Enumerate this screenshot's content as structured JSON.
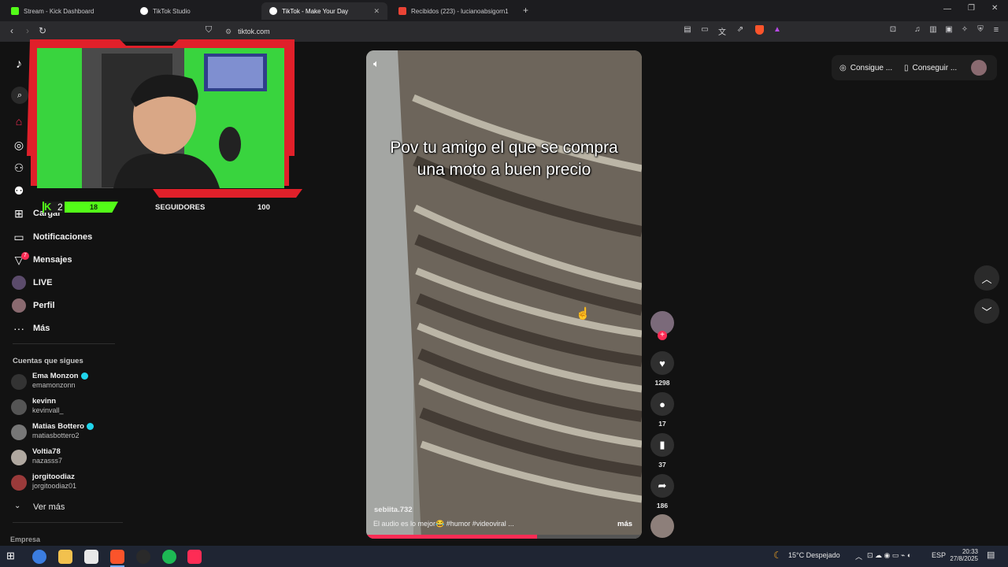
{
  "browser": {
    "tabs": [
      {
        "title": "Stream - Kick Dashboard",
        "color": "#53fc18"
      },
      {
        "title": "TikTok Studio",
        "color": "#ffffff"
      },
      {
        "title": "TikTok - Make Your Day",
        "color": "#ffffff"
      },
      {
        "title": "Recibidos (223) - lucianoabsigorn1@...",
        "color": "#ea4335"
      }
    ],
    "url": "tiktok.com",
    "new_tab_symbol": "+"
  },
  "webcam_overlay": {
    "kick_count": "2",
    "level": "18",
    "followers_label": "SEGUIDORES",
    "followers_value": "100",
    "accent": "#e0202a",
    "kick_green": "#53fc18"
  },
  "sidebar": {
    "items": [
      {
        "label": "Cargar",
        "icon": "upload-icon"
      },
      {
        "label": "Notificaciones",
        "icon": "notification-icon"
      },
      {
        "label": "Mensajes",
        "icon": "message-icon",
        "badge": "7"
      },
      {
        "label": "LIVE",
        "icon": "live-icon"
      },
      {
        "label": "Perfil",
        "icon": "profile-icon"
      },
      {
        "label": "Más",
        "icon": "more-icon"
      }
    ],
    "following_title": "Cuentas que sigues",
    "following": [
      {
        "name": "Ema Monzon",
        "handle": "emamonzonn",
        "verified": true
      },
      {
        "name": "kevinn",
        "handle": "kevinvall_",
        "verified": false
      },
      {
        "name": "Matias Bottero",
        "handle": "matiasbottero2",
        "verified": true
      },
      {
        "name": "Voltia78",
        "handle": "nazasss7",
        "verified": false
      },
      {
        "name": "jorgitoodiaz",
        "handle": "jorgitoodiaz01",
        "verified": false
      }
    ],
    "see_more": "Ver más",
    "footer": "Empresa"
  },
  "video": {
    "caption": "Pov tu amigo el que se compra una moto a buen precio",
    "author": "sebiita.732",
    "description": "El audio es lo mejor😂 #humor  #videoviral  ...",
    "more_label": "más",
    "progress": 0.62
  },
  "actions": {
    "likes": "1298",
    "comments": "17",
    "saves": "37",
    "shares": "186"
  },
  "top_right": {
    "coins": "Consigue ...",
    "app": "Conseguir ..."
  },
  "taskbar": {
    "weather": "15°C  Despejado",
    "lang": "ESP",
    "time": "20:33",
    "date": "27/8/2025"
  }
}
